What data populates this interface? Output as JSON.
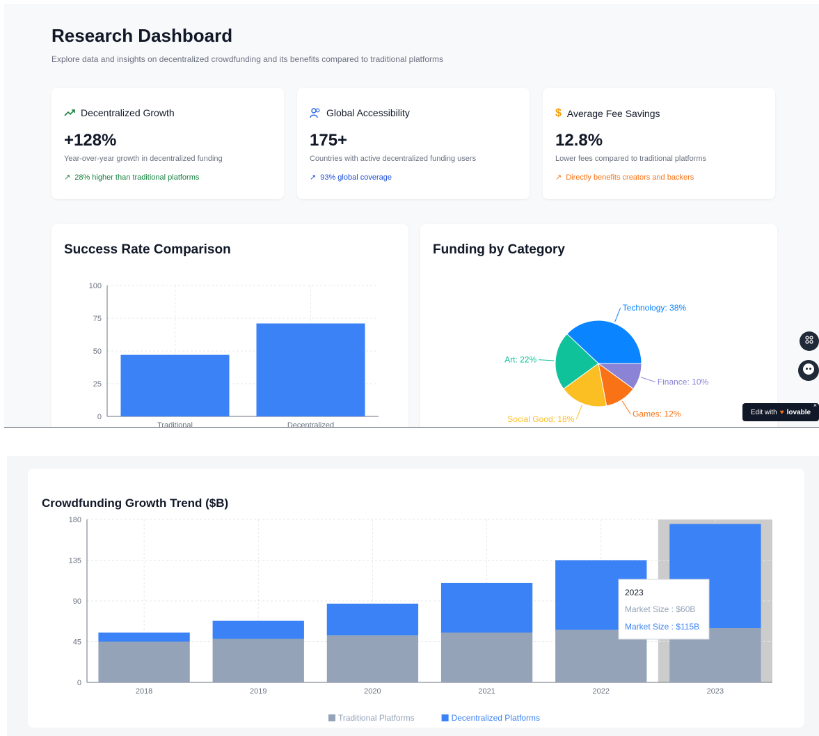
{
  "header": {
    "title": "Research Dashboard",
    "subtitle": "Explore data and insights on decentralized crowdfunding and its benefits compared to traditional platforms"
  },
  "stats": [
    {
      "icon": "trending-up-icon",
      "title": "Decentralized Growth",
      "value": "+128%",
      "description": "Year-over-year growth in decentralized funding",
      "note": "28% higher than traditional platforms",
      "note_color": "#15803d",
      "icon_color": "#15803d"
    },
    {
      "icon": "users-icon",
      "title": "Global Accessibility",
      "value": "175+",
      "description": "Countries with active decentralized funding users",
      "note": "93% global coverage",
      "note_color": "#1d4ed8",
      "icon_color": "#2563eb"
    },
    {
      "icon": "dollar-icon",
      "title": "Average Fee Savings",
      "value": "12.8%",
      "description": "Lower fees compared to traditional platforms",
      "note": "Directly benefits creators and backers",
      "note_color": "#f97316",
      "icon_color": "#f59e0b"
    }
  ],
  "success_card": {
    "title": "Success Rate Comparison"
  },
  "category_card": {
    "title": "Funding by Category"
  },
  "growth_card": {
    "title": "Crowdfunding Growth Trend ($B)"
  },
  "tooltip": {
    "year": "2023",
    "traditional": "Market Size : $60B",
    "decentralized": "Market Size : $115B"
  },
  "edit_badge": {
    "text": "Edit with",
    "brand": "lovable",
    "close": "×"
  },
  "colors": {
    "blue": "#3b82f6",
    "slate": "#94a3b8",
    "technology": "#0a84ff",
    "art": "#10c29a",
    "social": "#fbbf24",
    "games": "#f97316",
    "finance": "#8b83d6"
  },
  "chart_data": [
    {
      "type": "bar",
      "title": "Success Rate Comparison",
      "categories": [
        "Traditional",
        "Decentralized"
      ],
      "values": [
        47,
        71
      ],
      "ylim": [
        0,
        100
      ],
      "yticks": [
        0,
        25,
        50,
        75,
        100
      ],
      "grid": true
    },
    {
      "type": "pie",
      "title": "Funding by Category",
      "slices": [
        {
          "label": "Technology",
          "value": 38,
          "color": "#0a84ff"
        },
        {
          "label": "Finance",
          "value": 10,
          "color": "#8b83d6"
        },
        {
          "label": "Games",
          "value": 12,
          "color": "#f97316"
        },
        {
          "label": "Social Good",
          "value": 18,
          "color": "#fbbf24"
        },
        {
          "label": "Art",
          "value": 22,
          "color": "#10c29a"
        }
      ]
    },
    {
      "type": "bar",
      "stacked": true,
      "title": "Crowdfunding Growth Trend ($B)",
      "categories": [
        "2018",
        "2019",
        "2020",
        "2021",
        "2022",
        "2023"
      ],
      "series": [
        {
          "name": "Traditional Platforms",
          "values": [
            45,
            48,
            52,
            55,
            58,
            60
          ],
          "color": "#94a3b8"
        },
        {
          "name": "Decentralized Platforms",
          "values": [
            10,
            20,
            35,
            55,
            77,
            115
          ],
          "color": "#3b82f6"
        }
      ],
      "ylim": [
        0,
        180
      ],
      "yticks": [
        0,
        45,
        90,
        135,
        180
      ],
      "grid": true,
      "legend": "bottom",
      "highlighted_category": "2023"
    }
  ]
}
